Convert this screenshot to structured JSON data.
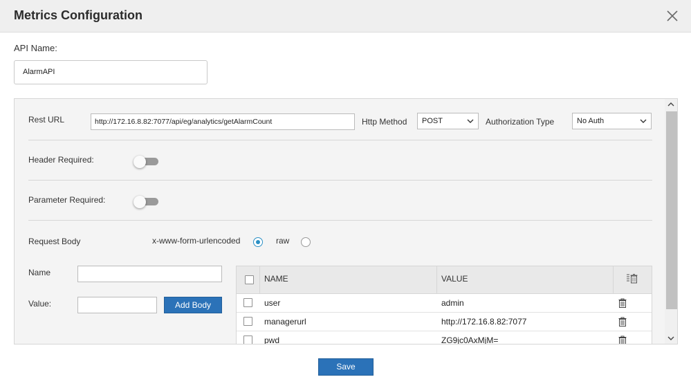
{
  "dialog": {
    "title": "Metrics Configuration",
    "close_icon": "close-icon"
  },
  "api": {
    "label": "API Name:",
    "value": "AlarmAPI"
  },
  "rest": {
    "url_label": "Rest URL",
    "url_value": "http://172.16.8.82:7077/api/eg/analytics/getAlarmCount",
    "method_label": "Http Method",
    "method_value": "POST",
    "auth_label": "Authorization Type",
    "auth_value": "No Auth"
  },
  "header_required": {
    "label": "Header Required:",
    "enabled": false
  },
  "parameter_required": {
    "label": "Parameter Required:",
    "enabled": false
  },
  "request_body": {
    "label": "Request Body",
    "options": [
      {
        "label": "x-www-form-urlencoded",
        "selected": true
      },
      {
        "label": "raw",
        "selected": false
      }
    ]
  },
  "body_form": {
    "name_label": "Name",
    "name_value": "",
    "value_label": "Value:",
    "value_value": "",
    "add_button": "Add Body"
  },
  "body_table": {
    "columns": [
      "NAME",
      "VALUE"
    ],
    "rows": [
      {
        "name": "user",
        "value": "admin"
      },
      {
        "name": "managerurl",
        "value": "http://172.16.8.82:7077"
      },
      {
        "name": "pwd",
        "value": "ZG9jc0AxMjM="
      }
    ]
  },
  "footer": {
    "save": "Save"
  },
  "colors": {
    "primary": "#2b72b8",
    "radio_accent": "#2a8fc4",
    "header_bg": "#efefef",
    "panel_bg": "#f4f4f4"
  }
}
